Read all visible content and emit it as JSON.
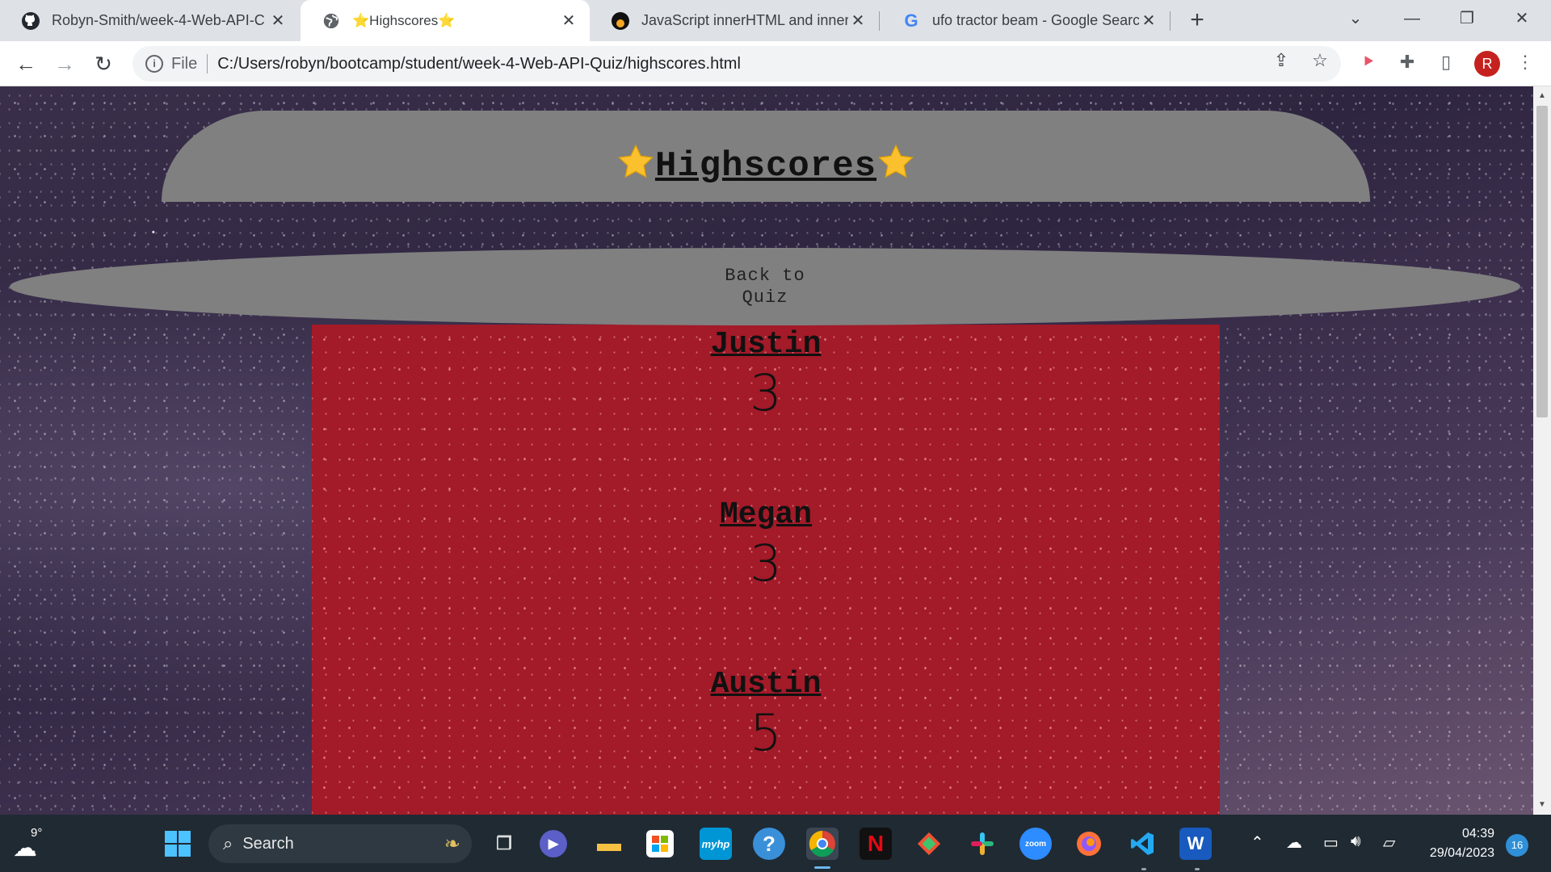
{
  "browser": {
    "tabs": [
      {
        "title": "Robyn-Smith/week-4-Web-API-C",
        "icon": "github-icon",
        "active": false
      },
      {
        "title": "⭐Highscores⭐",
        "icon": "globe-icon",
        "active": true
      },
      {
        "title": "JavaScript innerHTML and innerT",
        "icon": "medium-icon",
        "active": false
      },
      {
        "title": "ufo tractor beam - Google Searcl",
        "icon": "google-icon",
        "active": false
      }
    ],
    "new_tab": "+",
    "address": {
      "protocol": "File",
      "url": "C:/Users/robyn/bootcamp/student/week-4-Web-API-Quiz/highscores.html"
    },
    "profile_initial": "R"
  },
  "page": {
    "heading": "Highscores",
    "back_button": "Back to Quiz",
    "scores": [
      {
        "name": "Justin",
        "score": "3"
      },
      {
        "name": "Megan",
        "score": "3"
      },
      {
        "name": "Austin",
        "score": "5"
      }
    ]
  },
  "taskbar": {
    "weather_temp": "9°",
    "search_placeholder": "Search",
    "time": "04:39",
    "date": "29/04/2023",
    "notification_count": "16",
    "apps": [
      "start-icon",
      "task-view-icon",
      "teams-icon",
      "file-explorer-icon",
      "store-icon",
      "myhp-icon",
      "help-icon",
      "chrome-icon",
      "netflix-icon",
      "git-icon",
      "slack-icon",
      "zoom-icon",
      "firefox-icon",
      "vscode-icon",
      "word-icon"
    ],
    "myhp_label": "myhp",
    "zoom_label": "zoom",
    "netflix_label": "N",
    "word_label": "W"
  },
  "colors": {
    "page_red": "#a31a28",
    "saucer_gray": "#808080",
    "taskbar": "#1f2a33",
    "profile": "#c5221f"
  }
}
